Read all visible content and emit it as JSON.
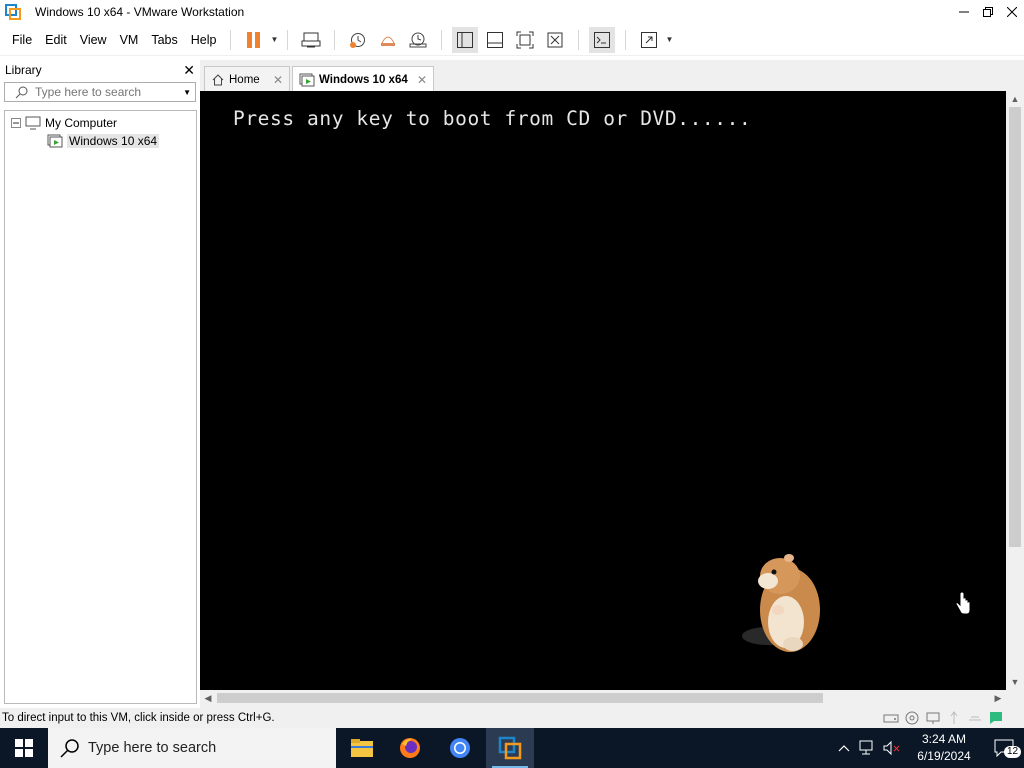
{
  "window": {
    "title": "Windows 10 x64 - VMware Workstation"
  },
  "menu": [
    "File",
    "Edit",
    "View",
    "VM",
    "Tabs",
    "Help"
  ],
  "toolbar": {
    "icons": [
      "pause-icon",
      "send-ctrl-alt-del-icon",
      "snapshot-icon",
      "revert-snapshot-icon",
      "snapshot-manager-icon",
      "show-library-icon",
      "thumbnail-bar-icon",
      "full-screen-icon",
      "unity-icon",
      "console-view-icon",
      "stretch-icon"
    ]
  },
  "library": {
    "title": "Library",
    "search_placeholder": "Type here to search",
    "tree": {
      "root": "My Computer",
      "child": "Windows 10 x64"
    }
  },
  "tabs": [
    {
      "label": "Home",
      "active": false
    },
    {
      "label": "Windows 10 x64",
      "active": true
    }
  ],
  "vm": {
    "boot_message": "Press any key to boot from CD or DVD......"
  },
  "status": {
    "message": "To direct input to this VM, click inside or press Ctrl+G."
  },
  "taskbar": {
    "search_placeholder": "Type here to search",
    "apps": [
      "file-explorer-icon",
      "firefox-icon",
      "chrome-icon",
      "vmware-workstation-icon"
    ],
    "time": "3:24 AM",
    "date": "6/19/2024",
    "notification_count": "12"
  },
  "colors": {
    "taskbar": "#0b1726",
    "vm_screen": "#000000",
    "pause": "#f0822d"
  }
}
